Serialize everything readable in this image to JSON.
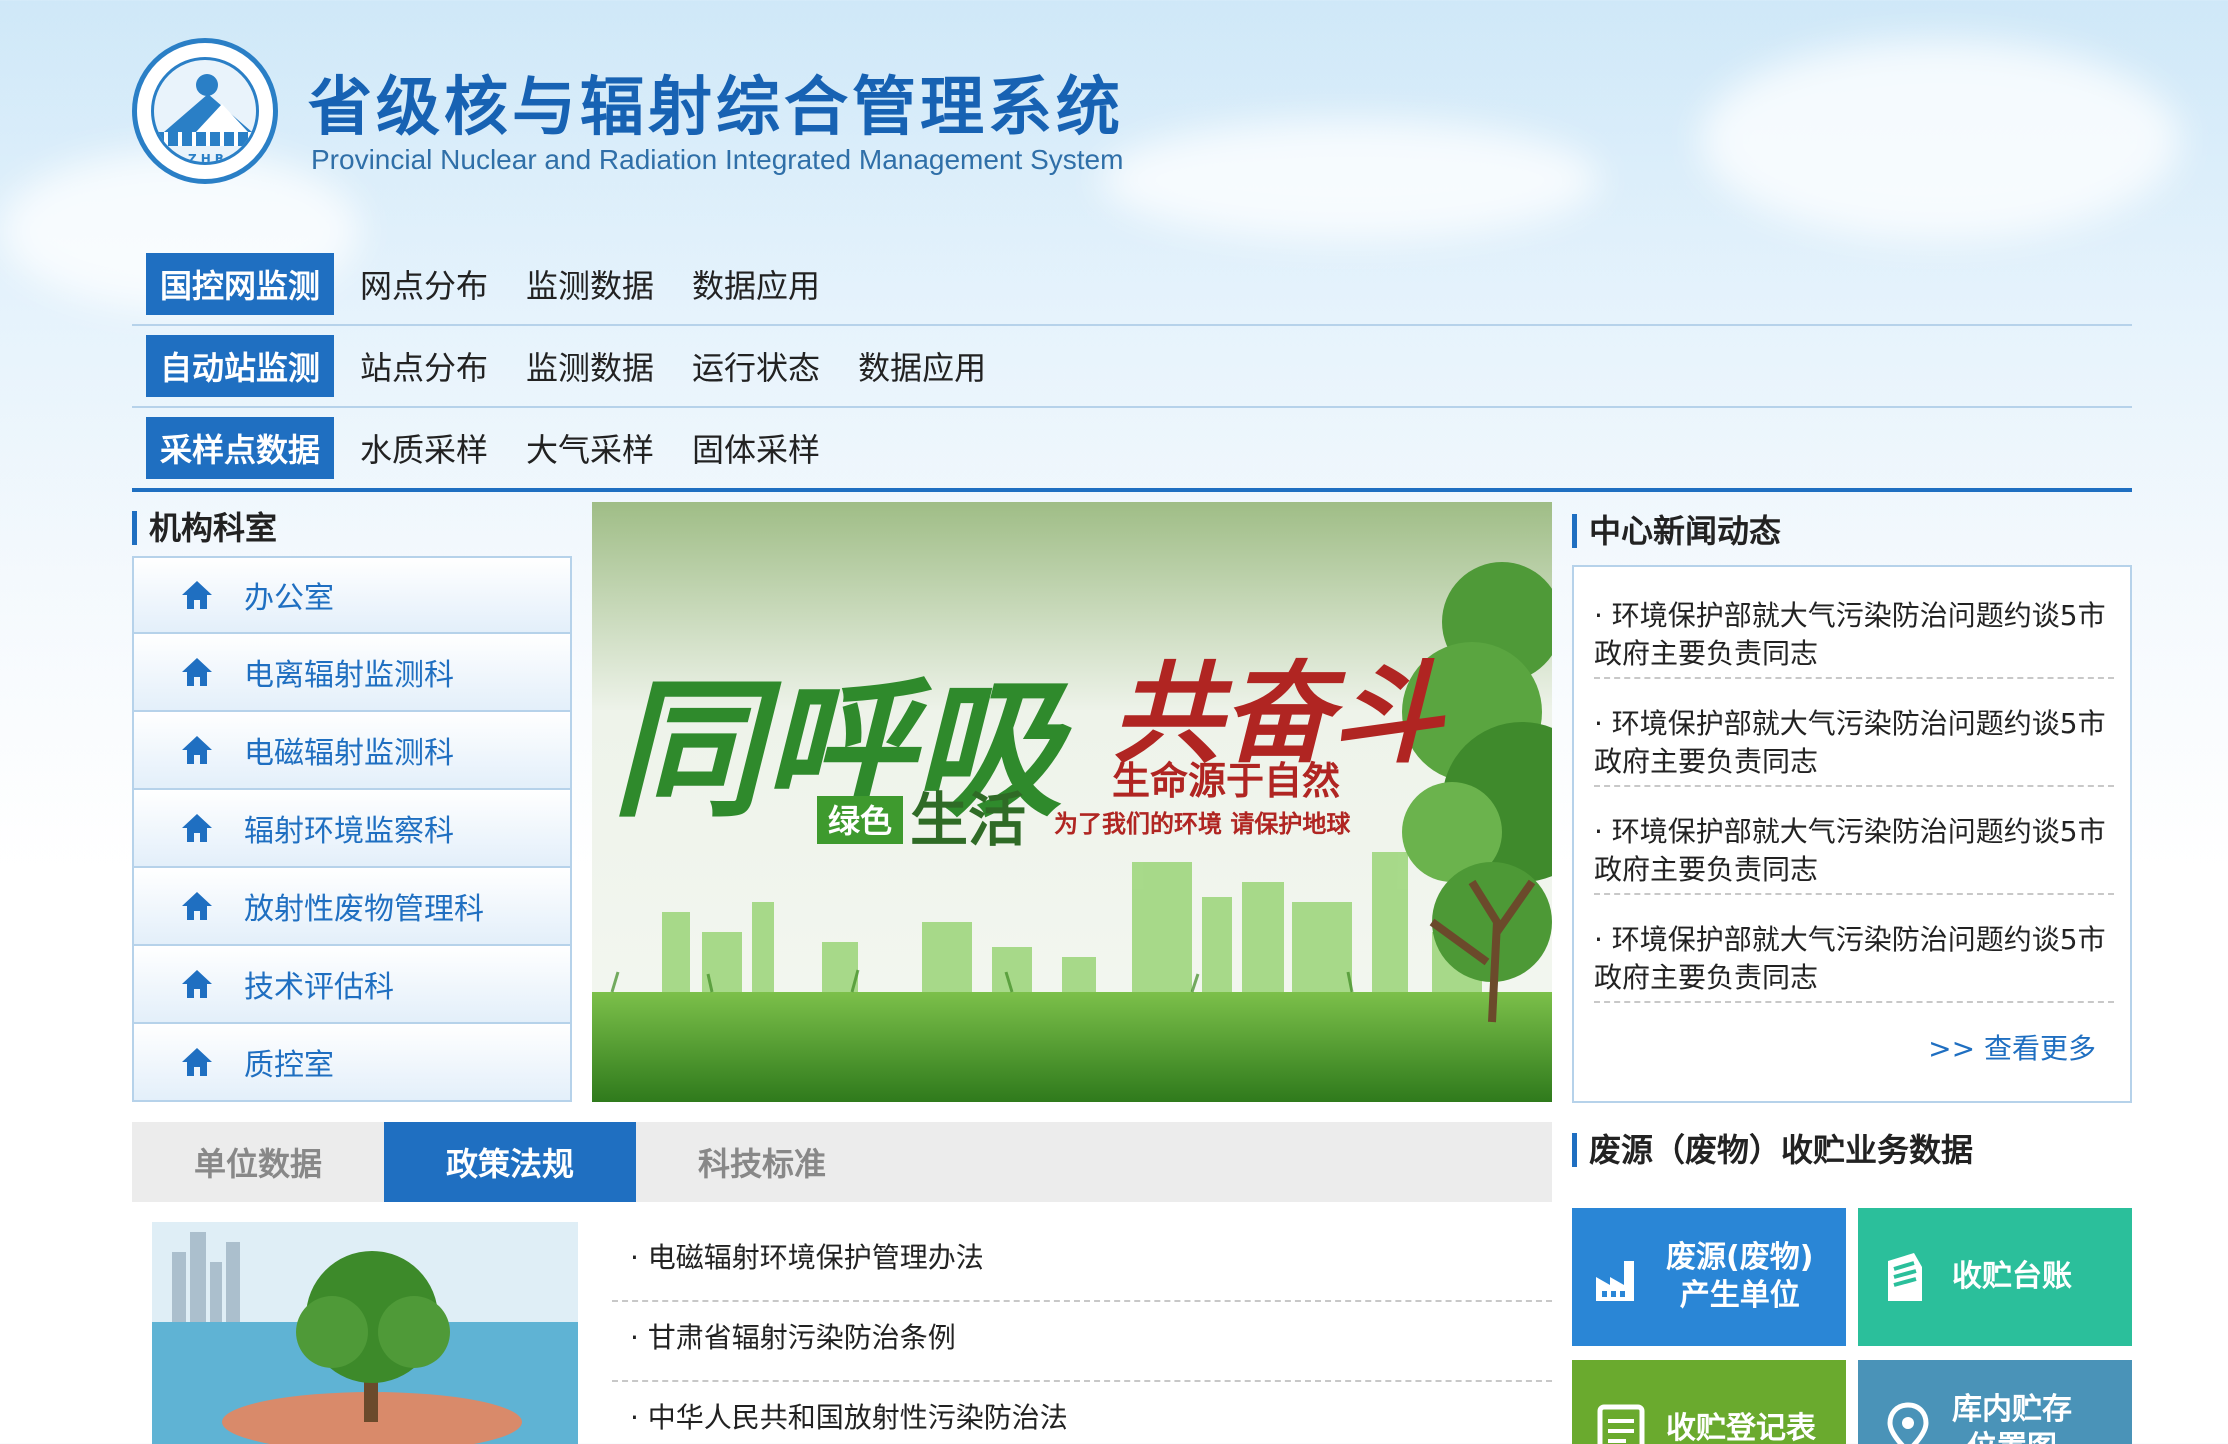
{
  "header": {
    "title": "省级核与辐射综合管理系统",
    "subtitle": "Provincial Nuclear and Radiation Integrated Management System",
    "logo_text": "ZHB"
  },
  "nav": {
    "rows": [
      {
        "category": "国控网监测",
        "links": [
          "网点分布",
          "监测数据",
          "数据应用"
        ]
      },
      {
        "category": "自动站监测",
        "links": [
          "站点分布",
          "监测数据",
          "运行状态",
          "数据应用"
        ]
      },
      {
        "category": "采样点数据",
        "links": [
          "水质采样",
          "大气采样",
          "固体采样"
        ]
      }
    ]
  },
  "departments": {
    "title": "机构科室",
    "items": [
      "办公室",
      "电离辐射监测科",
      "电磁辐射监测科",
      "辐射环境监察科",
      "放射性废物管理科",
      "技术评估科",
      "质控室"
    ]
  },
  "banner": {
    "headline_green": "同呼吸",
    "headline_red": "共奋斗",
    "tag": "绿色",
    "tag2": "生活",
    "slogan": "生命源于自然",
    "small": "为了我们的环境 请保护地球"
  },
  "news": {
    "title": "中心新闻动态",
    "items": [
      "· 环境保护部就大气污染防治问题约谈5市政府主要负责同志",
      "· 环境保护部就大气污染防治问题约谈5市政府主要负责同志",
      "· 环境保护部就大气污染防治问题约谈5市政府主要负责同志",
      "· 环境保护部就大气污染防治问题约谈5市政府主要负责同志"
    ],
    "more": ">> 查看更多"
  },
  "tabs": {
    "items": [
      "单位数据",
      "政策法规",
      "科技标准"
    ],
    "active_index": 1
  },
  "policies": {
    "items": [
      "· 电磁辐射环境保护管理办法",
      "· 甘肃省辐射污染防治条例",
      "· 中华人民共和国放射性污染防治法"
    ]
  },
  "waste": {
    "title": "废源（废物）收贮业务数据",
    "tiles": [
      {
        "label": "废源(废物)\n产生单位",
        "color": "#2a86d6",
        "icon": "factory-icon"
      },
      {
        "label": "收贮台账",
        "color": "#2bbf9b",
        "icon": "ledger-icon"
      },
      {
        "label": "收贮登记表",
        "color": "#6aaa2e",
        "icon": "form-icon"
      },
      {
        "label": "库内贮存\n位置图",
        "color": "#4a93b8",
        "icon": "map-pin-icon"
      }
    ]
  },
  "colors": {
    "brand": "#1f6fc1",
    "border": "#b6d2ea"
  }
}
